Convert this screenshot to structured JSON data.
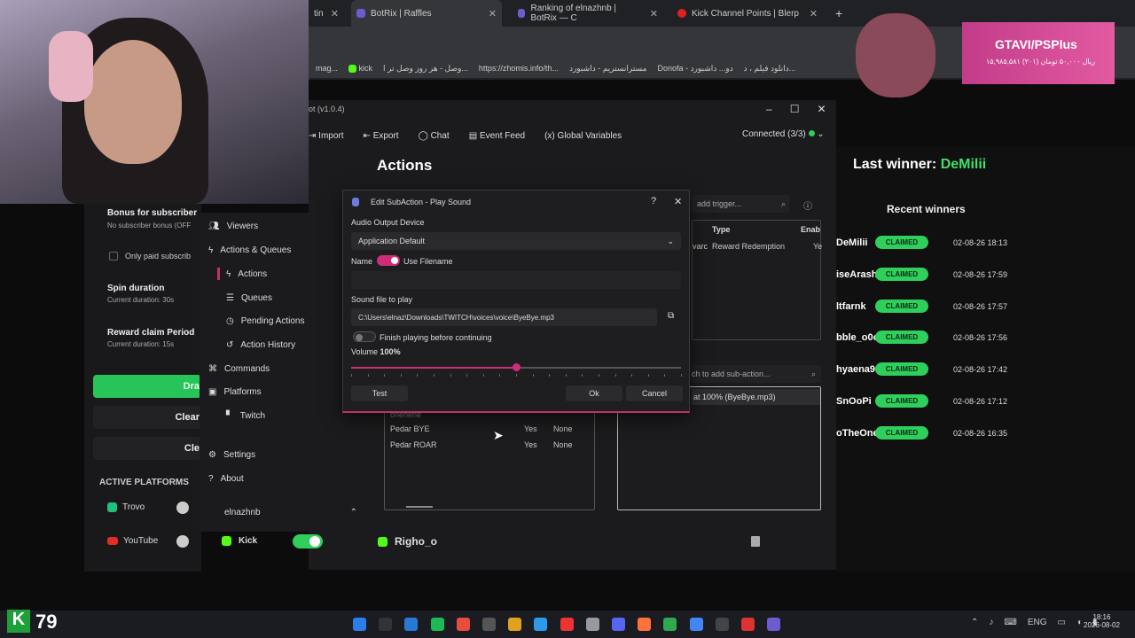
{
  "browser": {
    "tabs": [
      {
        "label": "BotRix | Raffles"
      },
      {
        "label": "Ranking of elnazhnb | BotRix — C"
      },
      {
        "label": "Kick Channel Points | Blerp"
      }
    ],
    "partial_tab": "tin",
    "bookmarks": [
      "kick",
      "وصل - هر روز وصل تر ا...",
      "https://zhomis.info/th...",
      "مسترانستریم - داشبورد",
      "Donofa - دو... داشبورد",
      "دانلود فیلم ، د..."
    ],
    "partial_left_text": "mag..."
  },
  "banner": {
    "title": "GTAVI/PSPlus",
    "subtitle": "۱۵,۹۸۵,۵۸۱ ریال ۵۰,۰۰۰ تومان (۲۰۱)"
  },
  "botapp": {
    "title_partial": "ot (v1.0.4)",
    "menu": [
      "Import",
      "Export",
      "Chat",
      "Event Feed",
      "Global Variables"
    ],
    "connected": "Connected (3/3)",
    "page_title": "Actions"
  },
  "sidebar": {
    "items": [
      "Viewers",
      "Actions & Queues",
      "Actions",
      "Queues",
      "Pending Actions",
      "Action History",
      "Commands",
      "Platforms",
      "Twitch",
      "Settings",
      "About"
    ],
    "user": "elnazhnb",
    "kick": "Kick"
  },
  "leftpanel": {
    "bonus_title": "Bonus for subscriber",
    "bonus_sub": "No subscriber bonus (OFF",
    "only_paid": "Only paid subscrib",
    "spin_title": "Spin duration",
    "spin_sub": "Current duration: 30s",
    "claim_title": "Reward claim Period",
    "claim_sub": "Current duration: 15s",
    "draw_btn": "Dra",
    "clear_btn": "Clear",
    "clear2_btn": "Cle",
    "active_platforms": "ACTIVE PLATFORMS",
    "trovo": "Trovo",
    "youtube": "YouTube"
  },
  "dialog": {
    "title": "Edit SubAction - Play Sound",
    "help": "?",
    "close": "✕",
    "audio_label": "Audio Output Device",
    "audio_value": "Application Default",
    "name_label": "Name",
    "use_filename": "Use Filename",
    "sound_label": "Sound file to play",
    "sound_path": "C:\\Users\\elnaz\\Downloads\\TWITCH\\voices\\voice\\ByeBye.mp3",
    "finish_label": "Finish playing before continuing",
    "volume_label": "Volume",
    "volume_value": "100%",
    "volume_slider_fraction": 0.5,
    "test": "Test",
    "ok": "Ok",
    "cancel": "Cancel"
  },
  "actions_table": {
    "rows": [
      {
        "name": "Pedar BYE",
        "enabled": "Yes",
        "group": "None"
      },
      {
        "name": "Pedar ROAR",
        "enabled": "Yes",
        "group": "None"
      }
    ],
    "partial_row": "onehene"
  },
  "triggers": {
    "search_placeholder": "add trigger...",
    "col_type": "Type",
    "col_enabled": "Enab",
    "row_partial": "varc",
    "row_type": "Reward Redemption",
    "row_enabled": "Ye"
  },
  "subactions": {
    "search_placeholder": "ch to add sub-action...",
    "row": "at 100% (ByeBye.mp3)"
  },
  "bottom_bar": {
    "name": "Righo_o"
  },
  "raffle": {
    "last_winner_label": "Last winner:",
    "last_winner": "DeMilii",
    "recent_title": "Recent winners",
    "winners": [
      {
        "name": "DeMilii",
        "status": "CLAIMED",
        "date": "02-08-26 18:13"
      },
      {
        "name": "iseArash",
        "status": "CLAIMED",
        "date": "02-08-26 17:59"
      },
      {
        "name": "ltfarnk",
        "status": "CLAIMED",
        "date": "02-08-26 17:57"
      },
      {
        "name": "bble_o0o",
        "status": "CLAIMED",
        "date": "02-08-26 17:56"
      },
      {
        "name": "hyaena9",
        "status": "CLAIMED",
        "date": "02-08-26 17:42"
      },
      {
        "name": "SnOoPi",
        "status": "CLAIMED",
        "date": "02-08-26 17:12"
      },
      {
        "name": "oTheOne",
        "status": "CLAIMED",
        "date": "02-08-26 16:35"
      }
    ]
  },
  "taskbar": {
    "clock_time": "18:16",
    "clock_date": "2026-08-02",
    "lang": "ENG",
    "stream_count": "79"
  },
  "colors": {
    "accent": "#c0306a",
    "green": "#2fcf5b",
    "raffle_green": "#3fe06b"
  }
}
